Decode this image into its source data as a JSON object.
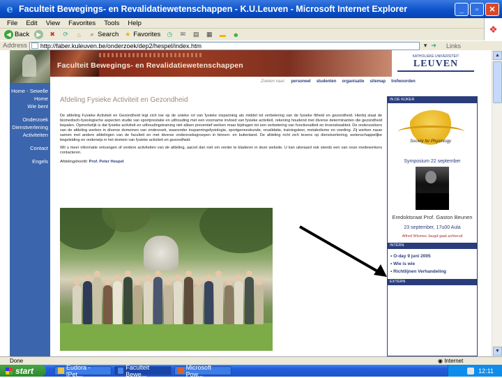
{
  "window": {
    "title": "Faculteit Bewegings- en Revalidatiewetenschappen - K.U.Leuven - Microsoft Internet Explorer"
  },
  "menu": [
    "File",
    "Edit",
    "View",
    "Favorites",
    "Tools",
    "Help"
  ],
  "toolbar": {
    "back_label": "Back",
    "search_label": "Search",
    "favorites_label": "Favorites"
  },
  "address": {
    "label": "Address",
    "url": "http://faber.kuleuven.be/onderzoek/dep2/hespel/index.htm",
    "links_label": "Links"
  },
  "site": {
    "banner_title": "Faculteit Bewegings- en Revalidatiewetenschappen",
    "logo_sub": "KATHOLIEKE UNIVERSITEIT",
    "logo_name": "LEUVEN",
    "topnav": [
      "Zoeken naar:",
      "personeel",
      "studenten",
      "organisatie",
      "sitemap",
      "trefwoorden"
    ],
    "sidebar": [
      "Home - Sewelle",
      "Home",
      "Wie bent",
      "Onderzoek",
      "Dienstverlening",
      "Activiteiten",
      "Contact",
      "Engels"
    ],
    "page_title": "Afdeling Fysieke Activiteit en Gezondheid",
    "intro_text": "De afdeling Fysieke Activiteit en Gezondheid legt zich toe op de unieke rol van fysieke inspanning als middel tot verbetering van de fysieke fitheid en gezondheid. Hierbij staat de biomedisch-fysiologische aspecten studie van sportprestatie en uithouding met een voorname invloed van fysieke activiteit, rekening houdend met diverse determinanten die gezondheid bepalen. Opmerkelijk is dat fysieke activiteit en uithoudingstraining niet alleen preventief werken maar bijdragen tot een verbetering van functionaliteit en levenskwaliteit. De onderzoekers van de afdeling werken in diverse domeinen van onderzoek, waaronder inspanningsfysiologie, sportgeneeskunde, revalidatie, trainingsleer, metabolisme en voeding. Zij werken nauw samen met andere afdelingen van de faculteit en met diverse onderzoeksgroepen in binnen- en buitenland. De afdeling richt zich tevens op dienstverlening, wetenschappelijke begeleiding en onderwijs in het domein van fysieke activiteit en gezondheid.",
    "intro_text2": "Wil u meer informatie ontvangen of verdere activiteiten van de afdeling, aarzel dan niet om verder te bladeren in deze website. U kan uiteraard ook steeds een van onze medewerkers contacteren.",
    "author_label": "Afdelingshoofd:",
    "author_name": "Prof. Peter Hespel",
    "panel": {
      "in_de_kijker": "IN DE KIJKER",
      "symp_logo_text": "Society for Physiology",
      "symp_caption": "Symposium 22 september",
      "eme_title": "Eredoktoraat Prof. Gaston Beunen",
      "eme_date": "23 september, 17u00 Aula",
      "eme_note": "Alfred Wismes Jaugd gaat achteruit",
      "intern": "INTERN",
      "intern_items": [
        "O-day 9 juni 2005",
        "Wie is wie",
        "Richtlijnen Verhandeling"
      ],
      "extern": "EXTERN"
    }
  },
  "status": {
    "text": "Done",
    "zone": "Internet"
  },
  "taskbar": {
    "start": "start",
    "tasks": [
      "Eudora - [Pet...",
      "Faculteit Bewe...",
      "Microsoft Pow..."
    ],
    "clock": "12:11"
  },
  "colors": {
    "site_blue": "#2a3d7a",
    "banner_red": "#7a1f14",
    "xp_blue": "#0a4fc8"
  }
}
